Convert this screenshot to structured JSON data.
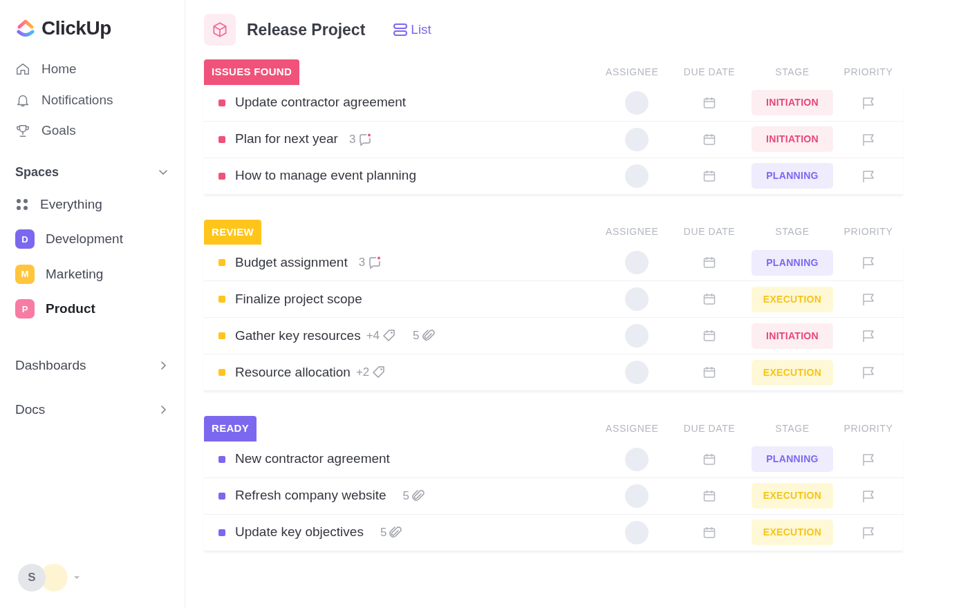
{
  "sidebar": {
    "logo": "ClickUp",
    "nav": [
      {
        "kind": "home",
        "label": "Home"
      },
      {
        "kind": "bell",
        "label": "Notifications"
      },
      {
        "kind": "trophy",
        "label": "Goals"
      }
    ],
    "spaces_heading": "Spaces",
    "spaces": [
      {
        "kind": "all",
        "label": "Everything",
        "selected": false
      },
      {
        "kind": "letter",
        "initial": "D",
        "label": "Development",
        "color": "#7b68ee",
        "selected": false
      },
      {
        "kind": "letter",
        "initial": "M",
        "label": "Marketing",
        "color": "#ffc53d",
        "selected": false
      },
      {
        "kind": "letter",
        "initial": "P",
        "label": "Product",
        "color": "#f77ba2",
        "selected": true
      }
    ],
    "sections": [
      {
        "label": "Dashboards"
      },
      {
        "label": "Docs"
      }
    ],
    "user": {
      "initial": "S"
    }
  },
  "header": {
    "project": "Release Project",
    "view": "List"
  },
  "groups": [
    {
      "status": "ISSUES FOUND",
      "color": "#f0527a",
      "columns": [
        "ASSIGNEE",
        "DUE DATE",
        "STAGE",
        "PRIORITY"
      ],
      "tasks": [
        {
          "name": "Update contractor agreement",
          "stage": "INITIATION",
          "kind": "initiation"
        },
        {
          "name": "Plan for next year",
          "comments": "3",
          "stage": "INITIATION",
          "kind": "initiation"
        },
        {
          "name": "How to manage event planning",
          "stage": "PLANNING",
          "kind": "planning"
        }
      ]
    },
    {
      "status": "REVIEW",
      "color": "#ffc51a",
      "columns": [
        "ASSIGNEE",
        "DUE DATE",
        "STAGE",
        "PRIORITY"
      ],
      "tasks": [
        {
          "name": "Budget assignment",
          "comments": "3",
          "stage": "PLANNING",
          "kind": "planning"
        },
        {
          "name": "Finalize project scope",
          "stage": "EXECUTION",
          "kind": "execution"
        },
        {
          "name": "Gather key resources",
          "tags": "+4",
          "attachments": "5",
          "stage": "INITIATION",
          "kind": "initiation"
        },
        {
          "name": "Resource allocation",
          "tags": "+2",
          "stage": "EXECUTION",
          "kind": "execution"
        }
      ]
    },
    {
      "status": "READY",
      "color": "#7b68ee",
      "columns": [
        "ASSIGNEE",
        "DUE DATE",
        "STAGE",
        "PRIORITY"
      ],
      "tasks": [
        {
          "name": "New contractor agreement",
          "stage": "PLANNING",
          "kind": "planning"
        },
        {
          "name": "Refresh company website",
          "attachments": "5",
          "stage": "EXECUTION",
          "kind": "execution"
        },
        {
          "name": "Update key objectives",
          "attachments": "5",
          "stage": "EXECUTION",
          "kind": "execution"
        }
      ]
    }
  ]
}
